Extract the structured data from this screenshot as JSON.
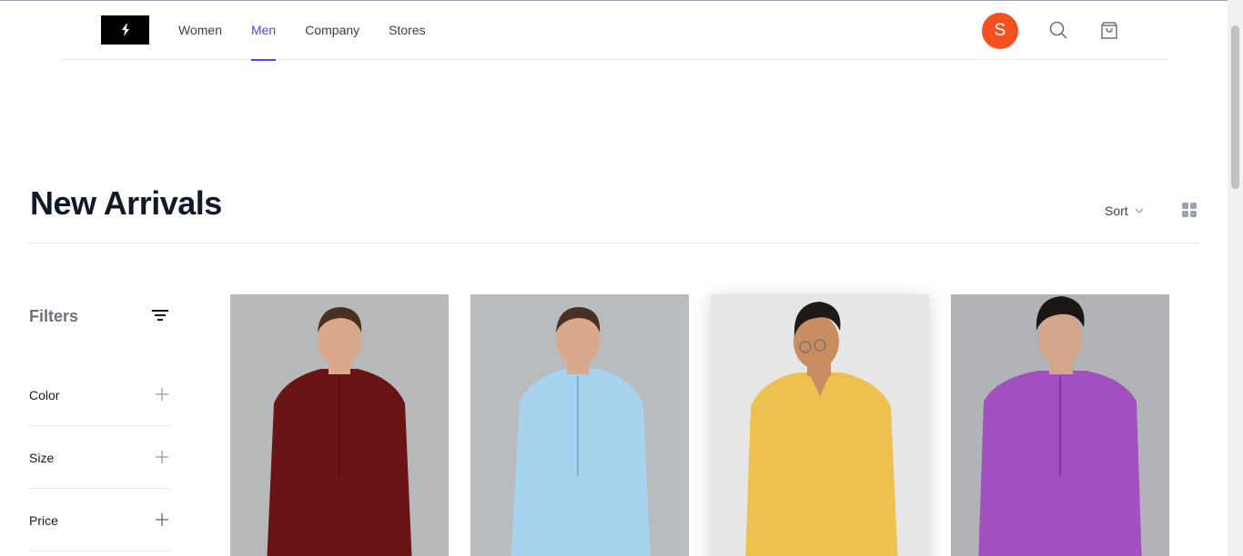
{
  "header": {
    "logo_glyph": "⚡",
    "nav": [
      {
        "label": "Women",
        "active": false
      },
      {
        "label": "Men",
        "active": true
      },
      {
        "label": "Company",
        "active": false
      },
      {
        "label": "Stores",
        "active": false
      }
    ],
    "avatar_initial": "S",
    "avatar_color": "#f4511e",
    "icons": [
      "search-icon",
      "shopping-bag-icon"
    ]
  },
  "page": {
    "title": "New Arrivals",
    "sort_label": "Sort"
  },
  "filters": {
    "title": "Filters",
    "groups": [
      {
        "label": "Color"
      },
      {
        "label": "Size"
      },
      {
        "label": "Price"
      }
    ]
  },
  "products": [
    {
      "shirt_color": "#6b1416",
      "background": "#b8b9bb"
    },
    {
      "shirt_color": "#a8d3ef",
      "background": "#b9bcbf"
    },
    {
      "shirt_color": "#edc14f",
      "background": "#e6e6e6"
    },
    {
      "shirt_color": "#a24fc0",
      "background": "#b2b3b6"
    }
  ],
  "colors": {
    "accent": "#4f46e5"
  }
}
